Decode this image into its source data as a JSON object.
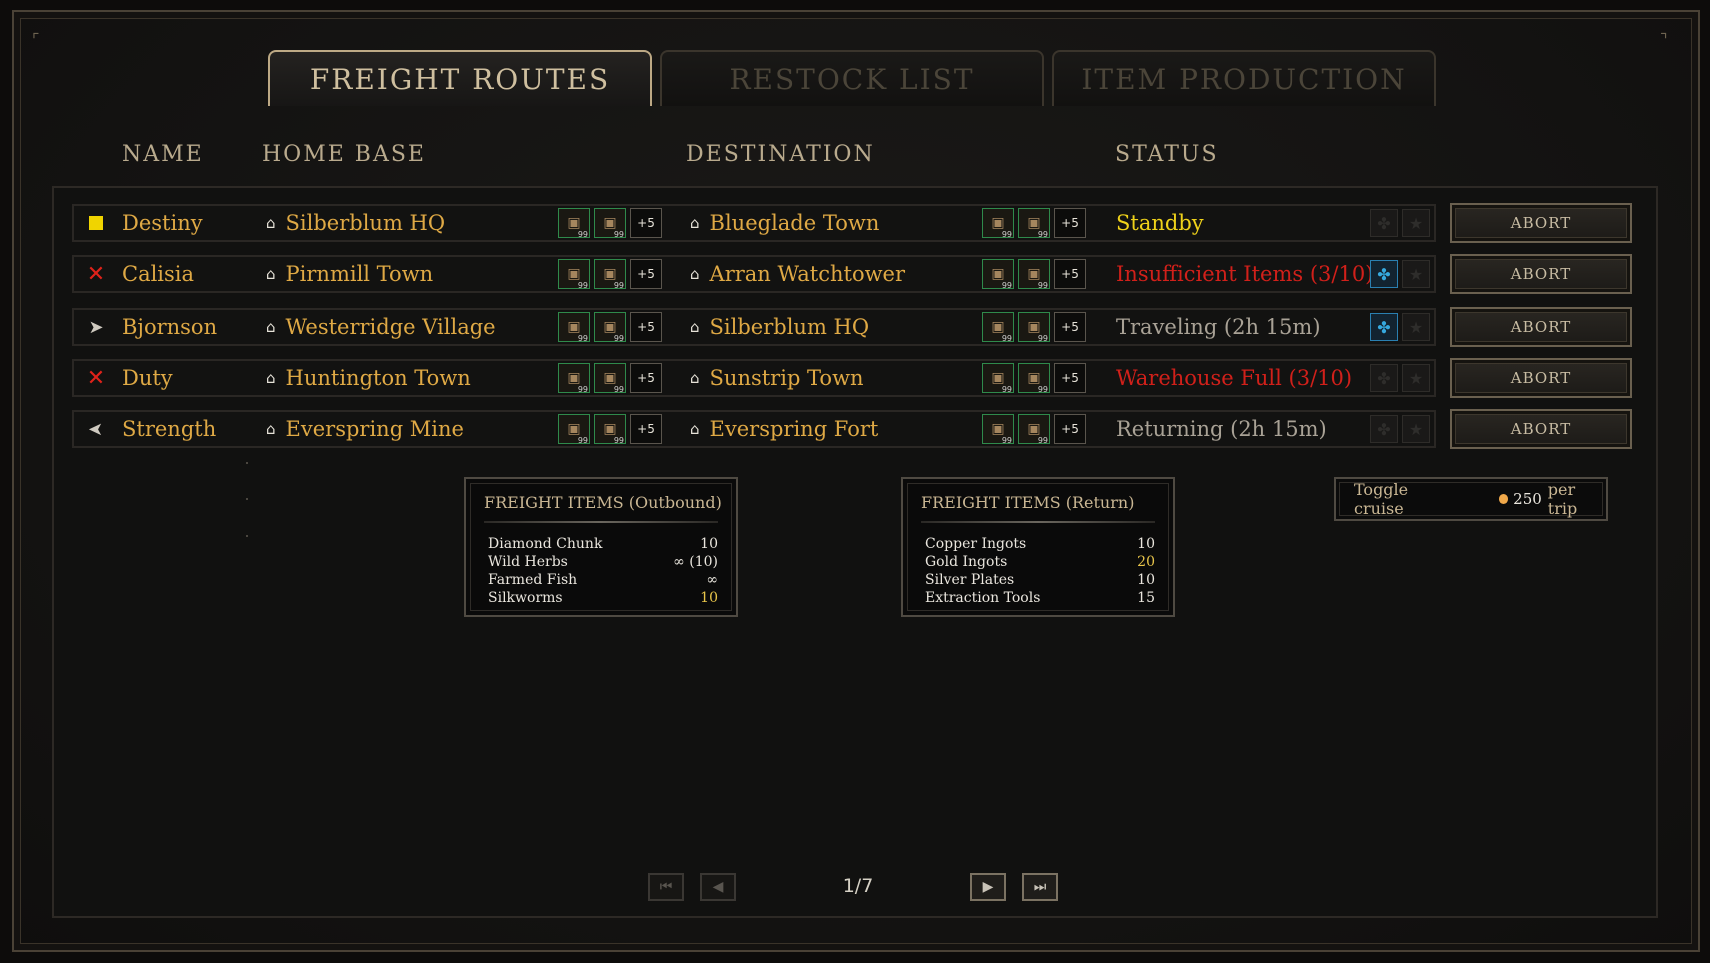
{
  "tabs": [
    "FREIGHT ROUTES",
    "RESTOCK LIST",
    "ITEM PRODUCTION"
  ],
  "columns": {
    "name": "NAME",
    "home": "HOME BASE",
    "dest": "DESTINATION",
    "status": "STATUS"
  },
  "routes": [
    {
      "icon": "standby-square-icon",
      "name": "Destiny",
      "home": "Silberblum HQ",
      "dest": "Blueglade Town",
      "status": "Standby",
      "status_color": "#efd21a",
      "pin_on": false,
      "abort": "ABORT"
    },
    {
      "icon": "x-icon",
      "name": "Calisia",
      "home": "Pirnmill Town",
      "dest": "Arran Watchtower",
      "status": "Insufficient Items (3/10)",
      "status_color": "#d1201a",
      "pin_on": true,
      "abort": "ABORT"
    },
    {
      "icon": "arrow-right-icon",
      "name": "Bjornson",
      "home": "Westerridge Village",
      "dest": "Silberblum HQ",
      "status": "Traveling (2h 15m)",
      "status_color": "#a9a296",
      "pin_on": true,
      "abort": "ABORT"
    },
    {
      "icon": "x-icon",
      "name": "Duty",
      "home": "Huntington Town",
      "dest": "Sunstrip Town",
      "status": "Warehouse Full (3/10)",
      "status_color": "#d1201a",
      "pin_on": false,
      "abort": "ABORT"
    },
    {
      "icon": "arrow-left-icon",
      "name": "Strength",
      "home": "Everspring Mine",
      "dest": "Everspring Fort",
      "status": "Returning (2h 15m)",
      "status_color": "#a9a296",
      "pin_on": false,
      "abort": "ABORT"
    }
  ],
  "more_items": "+5",
  "outbound": {
    "title": "FREIGHT ITEMS (Outbound)",
    "items": [
      {
        "name": "Diamond Chunk",
        "value": "10",
        "hi": false
      },
      {
        "name": "Wild Herbs",
        "value": "∞ (10)",
        "hi": false
      },
      {
        "name": "Farmed Fish",
        "value": "∞",
        "hi": false
      },
      {
        "name": "Silkworms",
        "value": "10",
        "hi": true
      }
    ]
  },
  "return": {
    "title": "FREIGHT ITEMS (Return)",
    "items": [
      {
        "name": "Copper Ingots",
        "value": "10",
        "hi": false
      },
      {
        "name": "Gold Ingots",
        "value": "20",
        "hi": true
      },
      {
        "name": "Silver Plates",
        "value": "10",
        "hi": false
      },
      {
        "name": "Extraction Tools",
        "value": "15",
        "hi": false
      }
    ]
  },
  "cruise": {
    "label": "Toggle cruise",
    "cost": "250",
    "unit": "per trip"
  },
  "pager": {
    "page": "1/7"
  }
}
